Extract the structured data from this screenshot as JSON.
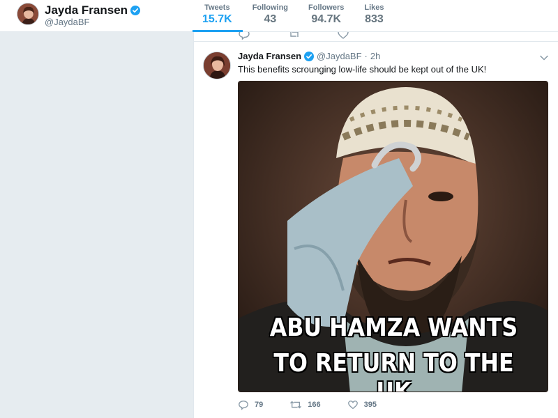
{
  "profile": {
    "name": "Jayda Fransen",
    "handle": "@JaydaBF",
    "verified_color": "#1da1f2"
  },
  "nav": [
    {
      "label": "Tweets",
      "value": "15.7K",
      "active": true
    },
    {
      "label": "Following",
      "value": "43",
      "active": false
    },
    {
      "label": "Followers",
      "value": "94.7K",
      "active": false
    },
    {
      "label": "Likes",
      "value": "833",
      "active": false
    }
  ],
  "tweet": {
    "name": "Jayda Fransen",
    "handle": "@JaydaBF",
    "separator": "·",
    "time": "2h",
    "text": "This benefits scrounging low-life should be kept out of the UK!",
    "media": {
      "caption_line1": "ABU HAMZA WANTS",
      "caption_line2": "TO RETURN TO THE UK"
    },
    "actions": {
      "replies": "79",
      "retweets": "166",
      "likes": "395"
    }
  },
  "colors": {
    "accent": "#1da1f2",
    "muted": "#657786",
    "background": "#e6ecf0"
  }
}
